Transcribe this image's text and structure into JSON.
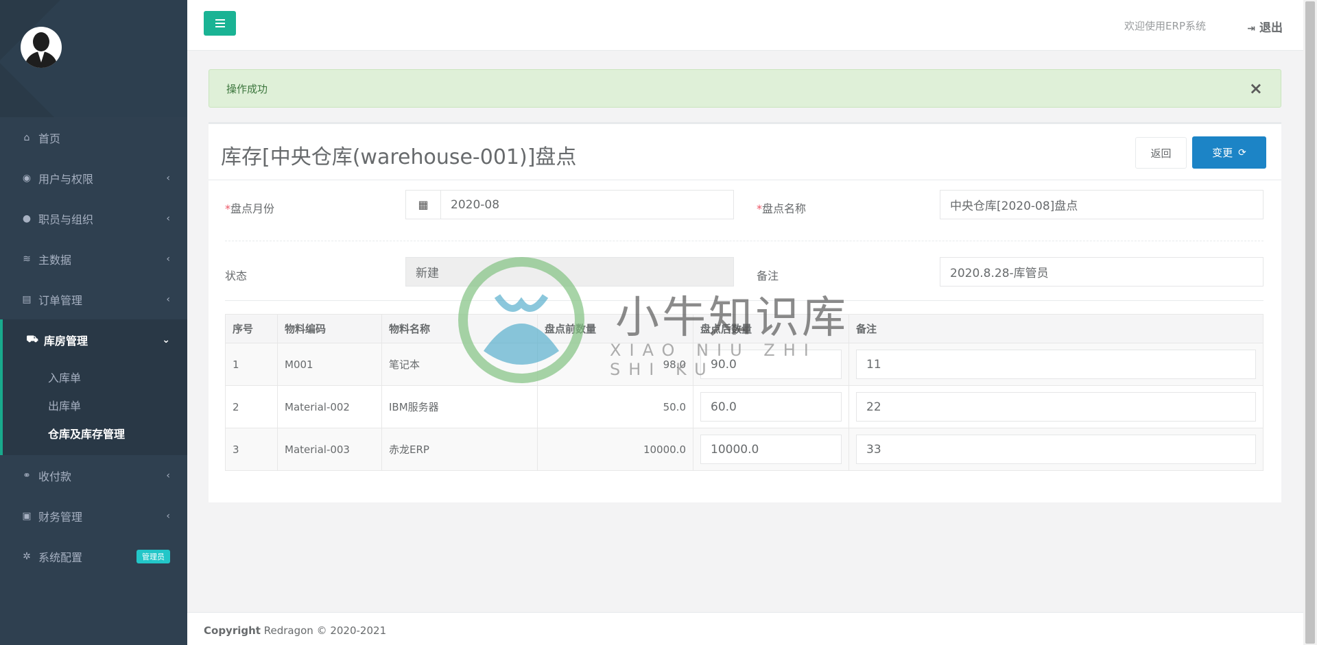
{
  "sidebar": {
    "items": [
      {
        "label": "首页",
        "icon": "home-icon"
      },
      {
        "label": "用户与权限",
        "icon": "lock-icon"
      },
      {
        "label": "职员与组织",
        "icon": "user-circle-icon"
      },
      {
        "label": "主数据",
        "icon": "database-icon"
      },
      {
        "label": "订单管理",
        "icon": "list-icon"
      },
      {
        "label": "库房管理",
        "icon": "truck-icon"
      },
      {
        "label": "收付款",
        "icon": "handshake-icon"
      },
      {
        "label": "财务管理",
        "icon": "money-icon"
      },
      {
        "label": "系统配置",
        "icon": "gear-icon",
        "badge": "管理员"
      }
    ],
    "subitems": [
      {
        "label": "入库单"
      },
      {
        "label": "出库单"
      },
      {
        "label": "仓库及库存管理"
      }
    ]
  },
  "header": {
    "welcome": "欢迎使用ERP系统",
    "logout": "退出"
  },
  "alert": {
    "message": "操作成功",
    "close": "×"
  },
  "panel": {
    "title": "库存[中央仓库(warehouse-001)]盘点",
    "back_label": "返回",
    "change_label": "变更"
  },
  "form": {
    "month_label": "盘点月份",
    "month_value": "2020-08",
    "name_label": "盘点名称",
    "name_value": "中央仓库[2020-08]盘点",
    "status_label": "状态",
    "status_value": "新建",
    "remark_label": "备注",
    "remark_value": "2020.8.28-库管员"
  },
  "table": {
    "headers": [
      "序号",
      "物料编码",
      "物料名称",
      "盘点前数量",
      "盘点后数量",
      "备注"
    ],
    "rows": [
      {
        "no": "1",
        "code": "M001",
        "name": "笔记本",
        "before": "98.0",
        "after": "90.0",
        "remark": "11"
      },
      {
        "no": "2",
        "code": "Material-002",
        "name": "IBM服务器",
        "before": "50.0",
        "after": "60.0",
        "remark": "22"
      },
      {
        "no": "3",
        "code": "Material-003",
        "name": "赤龙ERP",
        "before": "10000.0",
        "after": "10000.0",
        "remark": "33"
      }
    ]
  },
  "footer": {
    "copyright_label": "Copyright",
    "copyright_text": "Redragon © 2020-2021"
  },
  "watermark": {
    "title": "小牛知识库",
    "subtitle": "XIAO NIU ZHI SHI KU"
  },
  "colors": {
    "sidebar_bg": "#2f4050",
    "accent_green": "#1ab394",
    "primary_blue": "#1c84c6",
    "alert_bg": "#dff0d8",
    "badge": "#23c6c8"
  }
}
